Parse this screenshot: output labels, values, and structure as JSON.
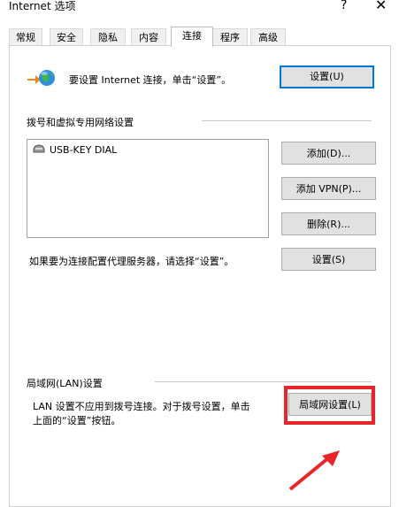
{
  "window": {
    "title": "Internet 选项",
    "help_glyph": "?",
    "close_glyph": "✕"
  },
  "tabs": [
    {
      "label": "常规"
    },
    {
      "label": "安全"
    },
    {
      "label": "隐私"
    },
    {
      "label": "内容"
    },
    {
      "label": "连接",
      "active": true
    },
    {
      "label": "程序"
    },
    {
      "label": "高级"
    }
  ],
  "setup": {
    "text": "要设置 Internet 连接，单击“设置”。",
    "button": "设置(U)"
  },
  "dialup": {
    "section_title": "拨号和虚拟专用网络设置",
    "connections": [
      {
        "label": "USB-KEY DIAL",
        "icon": "modem-icon"
      }
    ],
    "add_button": "添加(D)...",
    "add_vpn_button": "添加 VPN(P)...",
    "remove_button": "删除(R)...",
    "proxy_text": "如果要为连接配置代理服务器，请选择“设置”。",
    "settings_button": "设置(S)"
  },
  "lan": {
    "section_title": "局域网(LAN)设置",
    "desc_line1": "LAN 设置不应用到拨号连接。对于拨号设置，单击",
    "desc_line2": "上面的“设置”按钮。",
    "button": "局域网设置(L)"
  },
  "colors": {
    "highlight": "#e8262a",
    "default_button_border": "#0078d7"
  }
}
